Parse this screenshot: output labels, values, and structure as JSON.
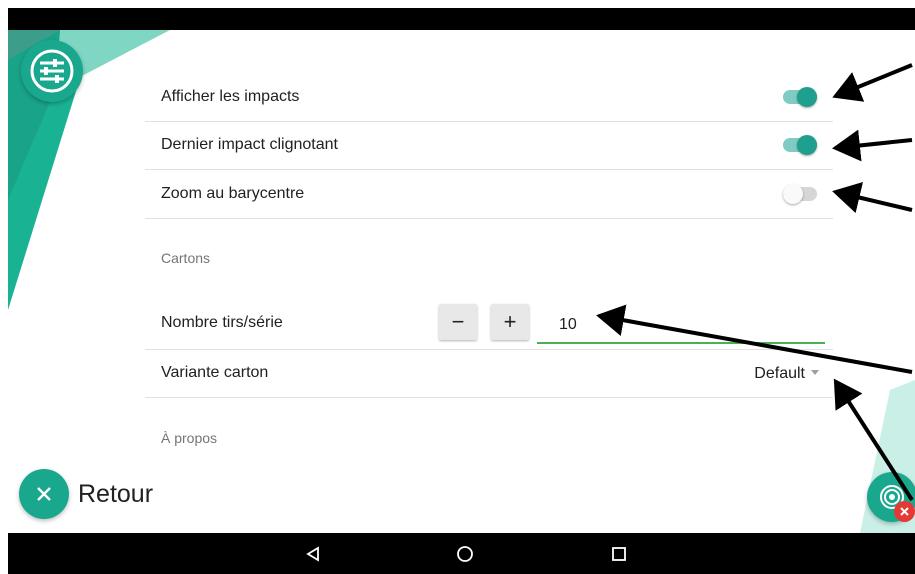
{
  "colors": {
    "accent": "#19a88e",
    "toggle_on_thumb": "#1fa08e",
    "toggle_on_track": "#80cbc4",
    "input_underline": "#4caf50",
    "badge": "#e53935"
  },
  "settings_button": {
    "icon": "sliders-icon"
  },
  "display": {
    "show_impacts": {
      "label": "Afficher les impacts",
      "enabled": true
    },
    "blink_last_impact": {
      "label": "Dernier impact clignotant",
      "enabled": true
    },
    "zoom_barycenter": {
      "label": "Zoom au barycentre",
      "enabled": false
    }
  },
  "cards_section": {
    "title": "Cartons"
  },
  "shots_per_series": {
    "label": "Nombre tirs/série",
    "value": "10",
    "minus": "−",
    "plus": "+"
  },
  "card_variant": {
    "label": "Variante carton",
    "value": "Default"
  },
  "about_section": {
    "title": "À propos"
  },
  "back": {
    "label": "Retour",
    "icon": "close-icon"
  },
  "target_button": {
    "icon": "target-icon",
    "badge_icon": "close-icon"
  },
  "system_nav": {
    "back": "triangle-back-icon",
    "home": "circle-home-icon",
    "recents": "square-recents-icon"
  }
}
